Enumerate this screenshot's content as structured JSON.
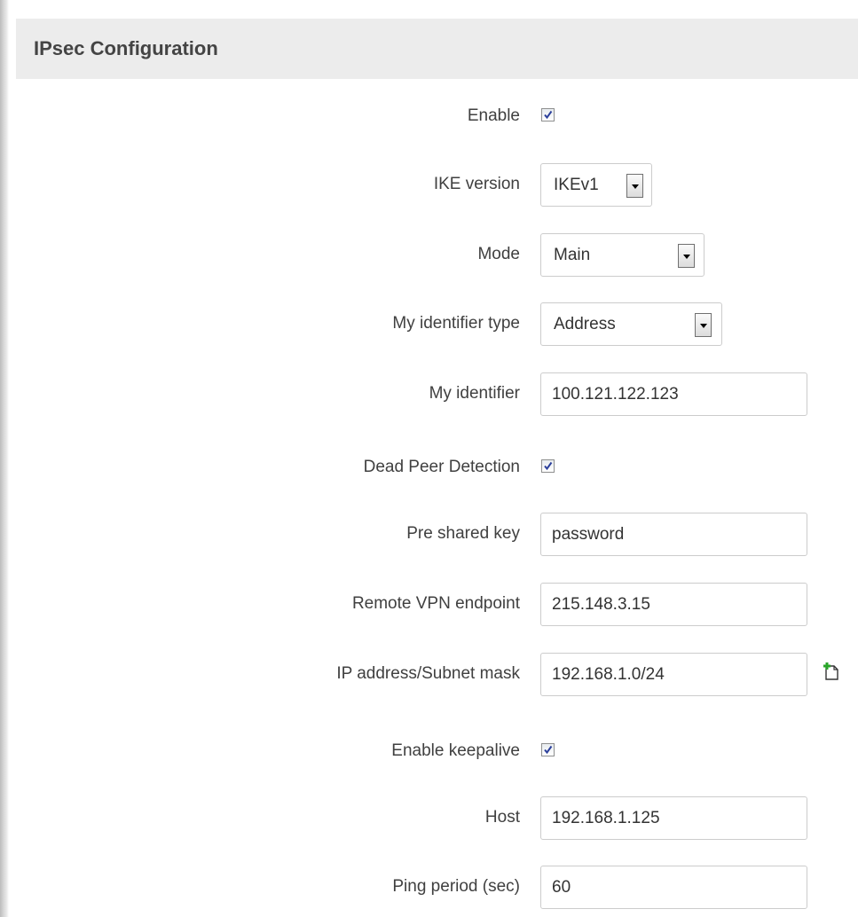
{
  "section": {
    "title": "IPsec Configuration"
  },
  "fields": {
    "enable": {
      "label": "Enable",
      "checked": true
    },
    "ike_version": {
      "label": "IKE version",
      "value": "IKEv1"
    },
    "mode": {
      "label": "Mode",
      "value": "Main"
    },
    "my_identifier_type": {
      "label": "My identifier type",
      "value": "Address"
    },
    "my_identifier": {
      "label": "My identifier",
      "value": "100.121.122.123"
    },
    "dead_peer_detection": {
      "label": "Dead Peer Detection",
      "checked": true
    },
    "pre_shared_key": {
      "label": "Pre shared key",
      "value": "password"
    },
    "remote_vpn_endpoint": {
      "label": "Remote VPN endpoint",
      "value": "215.148.3.15"
    },
    "ip_subnet": {
      "label": "IP address/Subnet mask",
      "value": "192.168.1.0/24",
      "add_icon": "add-document-icon"
    },
    "enable_keepalive": {
      "label": "Enable keepalive",
      "checked": true
    },
    "host": {
      "label": "Host",
      "value": "192.168.1.125"
    },
    "ping_period": {
      "label": "Ping period (sec)",
      "value": "60"
    }
  },
  "colors": {
    "header_bg": "#ececec",
    "check_blue": "#2b3f9b",
    "add_icon_green": "#2aa52a"
  }
}
